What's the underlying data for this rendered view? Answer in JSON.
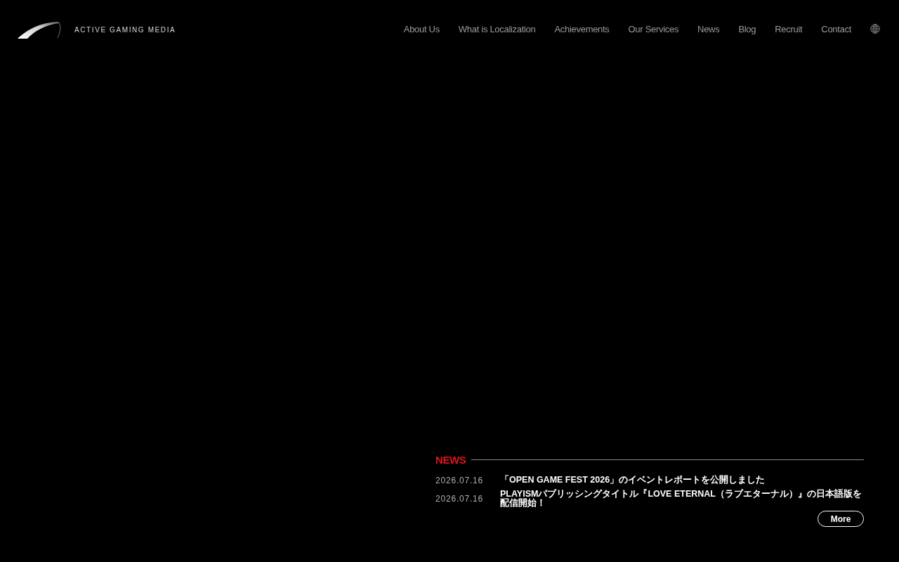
{
  "header": {
    "logo": {
      "text": "ACTIVE GAMING MEDIA"
    },
    "nav": [
      {
        "label": "About Us"
      },
      {
        "label": "What is Localization"
      },
      {
        "label": "Achievements"
      },
      {
        "label": "Our Services"
      },
      {
        "label": "News"
      },
      {
        "label": "Blog"
      },
      {
        "label": "Recruit"
      },
      {
        "label": "Contact"
      }
    ]
  },
  "news": {
    "title": "NEWS",
    "items": [
      {
        "date": "2026.07.16",
        "title": "「OPEN GAME FEST 2026」のイベントレポートを公開しました"
      },
      {
        "date": "2026.07.16",
        "title": "PLAYISMパブリッシングタイトル『LOVE ETERNAL（ラブエターナル）』の日本語版を配信開始！"
      }
    ],
    "more_button": "More"
  }
}
